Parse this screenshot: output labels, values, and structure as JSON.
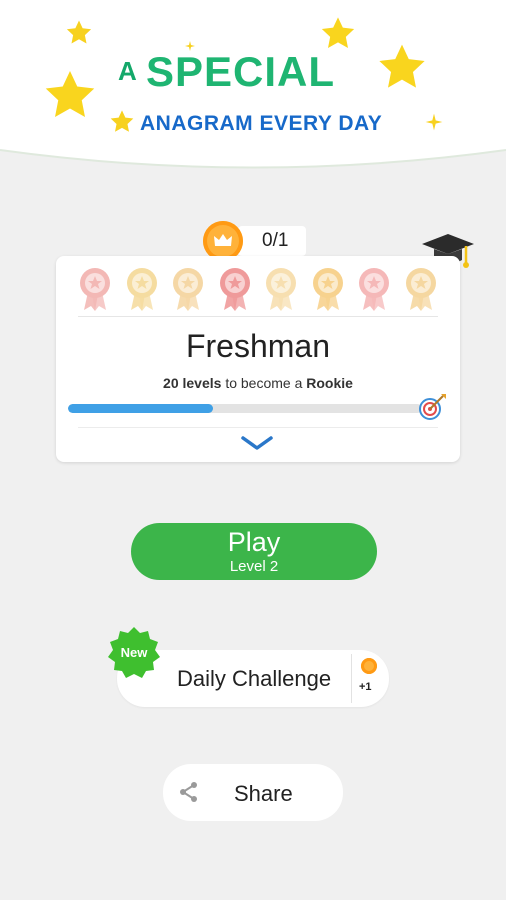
{
  "banner": {
    "prefix": "A",
    "headline": "SPECIAL",
    "subheadline": "ANAGRAM EVERY DAY"
  },
  "coins": {
    "count": "0/1"
  },
  "rank_card": {
    "rank": "Freshman",
    "levels_count": "20 levels",
    "levels_middle": " to become a ",
    "next_rank": "Rookie",
    "progress": 0.41,
    "badges": [
      {
        "icon": "rosette-badge-icon",
        "color": "#f3b8b5"
      },
      {
        "icon": "rosette-badge-icon",
        "color": "#f5dca0"
      },
      {
        "icon": "medal-badge-icon",
        "color": "#f5d7a5"
      },
      {
        "icon": "star-medal-badge-icon",
        "color": "#ef9a9a"
      },
      {
        "icon": "sheriff-star-badge-icon",
        "color": "#f7dfb0"
      },
      {
        "icon": "ribbon-badge-icon",
        "color": "#f7d28e"
      },
      {
        "icon": "ribbon-badge-icon",
        "color": "#f5b8b8"
      },
      {
        "icon": "ribbon-badge-icon",
        "color": "#f5d7a0"
      }
    ]
  },
  "play": {
    "label": "Play",
    "sub": "Level 2"
  },
  "daily": {
    "new_tag": "New",
    "label": "Daily Challenge",
    "reward": "+1"
  },
  "share": {
    "label": "Share"
  },
  "colors": {
    "green": "#3cb54a",
    "blue": "#3fa0e6",
    "coin": "#ffb23a",
    "badge_green": "#3fbf2f"
  }
}
